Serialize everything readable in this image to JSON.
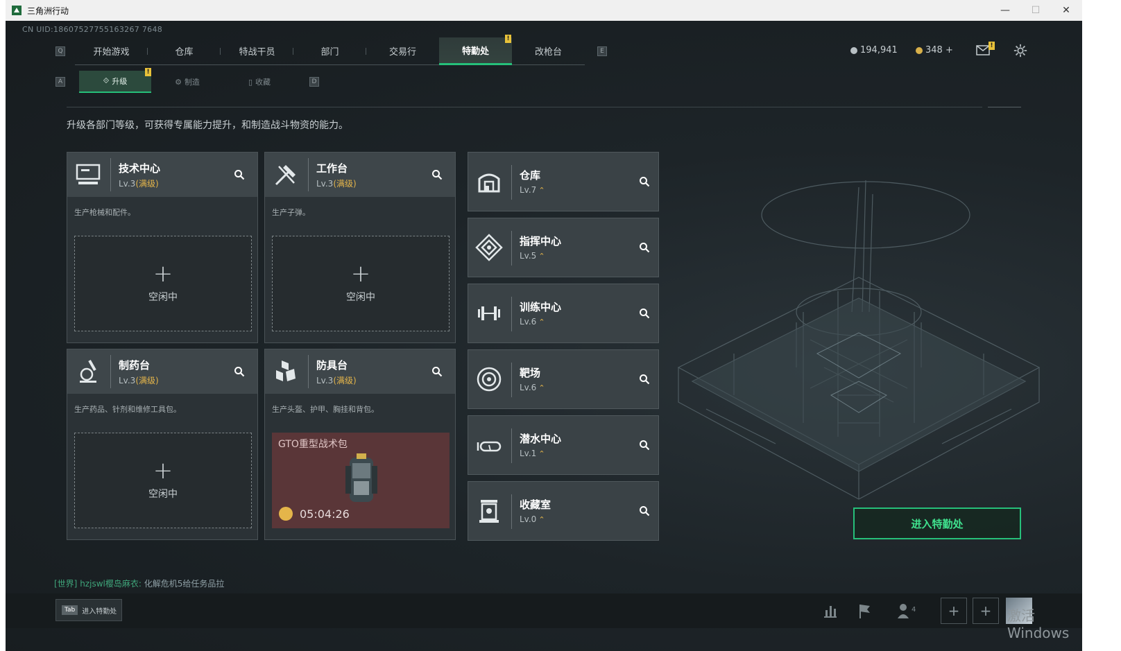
{
  "window": {
    "title": "三角洲行动",
    "min": "—",
    "max": "☐",
    "close": "✕"
  },
  "uid": "CN UID:18607527755163267 7648",
  "nav": {
    "left_key": "Q",
    "right_key": "E",
    "tabs": [
      "开始游戏",
      "仓库",
      "特战干员",
      "部门",
      "交易行",
      "特勤处",
      "改枪台"
    ],
    "active_index": 5,
    "badge": "!"
  },
  "currency": {
    "silver": "194,941",
    "gold": "348 +"
  },
  "subnav": {
    "left_key": "A",
    "right_key": "D",
    "tabs": [
      "升级",
      "制造",
      "收藏"
    ],
    "active_index": 0,
    "badge": "!"
  },
  "intro": "升级各部门等级，可获得专属能力提升，和制造战斗物资的能力。",
  "stations": [
    {
      "name": "技术中心",
      "level": "Lv.3",
      "max": "(满级)",
      "desc": "生产枪械和配件。",
      "icon": "computer-icon",
      "status": "空闲中"
    },
    {
      "name": "工作台",
      "level": "Lv.3",
      "max": "(满级)",
      "desc": "生产子弹。",
      "icon": "tools-icon",
      "status": "空闲中"
    },
    {
      "name": "制药台",
      "level": "Lv.3",
      "max": "(满级)",
      "desc": "生产药品、针剂和维修工具包。",
      "icon": "microscope-icon",
      "status": "空闲中"
    },
    {
      "name": "防具台",
      "level": "Lv.3",
      "max": "(满级)",
      "desc": "生产头盔、护甲、胸挂和背包。",
      "icon": "armor-icon",
      "craft_item": "GTO重型战术包",
      "craft_timer": "05:04:26"
    }
  ],
  "departments": [
    {
      "name": "仓库",
      "level": "Lv.7",
      "icon": "warehouse-icon"
    },
    {
      "name": "指挥中心",
      "level": "Lv.5",
      "icon": "command-icon"
    },
    {
      "name": "训练中心",
      "level": "Lv.6",
      "icon": "dumbbell-icon"
    },
    {
      "name": "靶场",
      "level": "Lv.6",
      "icon": "target-icon"
    },
    {
      "name": "潜水中心",
      "level": "Lv.1",
      "icon": "diving-mask-icon"
    },
    {
      "name": "收藏室",
      "level": "Lv.0",
      "icon": "collection-icon"
    }
  ],
  "plus": "+",
  "up_arrow": "⌃",
  "enter_button": "进入特勤处",
  "chat": {
    "channel": "[世界]",
    "user": "hzjswl樱岛麻衣:",
    "message": "化解危机5给任务品拉"
  },
  "tab_hint": {
    "key": "Tab",
    "label": "进入特勤处"
  },
  "friends_count": "4",
  "watermark": "激活 Windows",
  "colors": {
    "accent": "#26c07a",
    "gold": "#e4b54a",
    "craft_bg": "#5a3638"
  }
}
